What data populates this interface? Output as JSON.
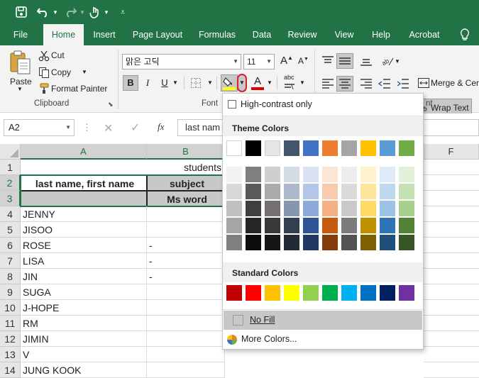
{
  "tabs": [
    "File",
    "Home",
    "Insert",
    "Page Layout",
    "Formulas",
    "Data",
    "Review",
    "View",
    "Help",
    "Acrobat"
  ],
  "clipboard": {
    "paste": "Paste",
    "cut": "Cut",
    "copy": "Copy",
    "format_painter": "Format Painter",
    "label": "Clipboard"
  },
  "font": {
    "name": "맑은 고딕",
    "size": "11",
    "label": "Font",
    "grow": "A",
    "shrink": "A",
    "bold": "B",
    "italic": "I",
    "underline": "U",
    "font_color_letter": "A",
    "phonetic": "abc"
  },
  "alignment": {
    "wrap_text": "Wrap Text",
    "merge": "Merge & Cer",
    "label": "nt"
  },
  "formula_bar": {
    "name_box": "A2",
    "fx": "fx",
    "content": "last nam"
  },
  "columns": [
    "A",
    "B",
    "F"
  ],
  "rows": [
    "1",
    "2",
    "3",
    "4",
    "5",
    "6",
    "7",
    "8",
    "9",
    "10",
    "11",
    "12",
    "13",
    "14"
  ],
  "cells": {
    "b1": "students",
    "a2": "last name, first name",
    "b2": "subject",
    "b3": "Ms word",
    "names": [
      "JENNY",
      "JISOO",
      "ROSE",
      "LISA",
      "JIN",
      "SUGA",
      "J-HOPE",
      "RM",
      "JIMIN",
      "V",
      "JUNG KOOK"
    ],
    "dash": "-"
  },
  "fill_menu": {
    "high_contrast": "High-contrast only",
    "theme_colors": "Theme Colors",
    "standard_colors": "Standard Colors",
    "no_fill": "No Fill",
    "more_colors": "More Colors...",
    "theme_top": [
      "#ffffff",
      "#000000",
      "#e7e6e6",
      "#44546a",
      "#4472c4",
      "#ed7d31",
      "#a5a5a5",
      "#ffc000",
      "#5b9bd5",
      "#70ad47"
    ],
    "theme_shades": [
      [
        "#f2f2f2",
        "#7f7f7f",
        "#d0cece",
        "#d6dce4",
        "#d9e2f3",
        "#fbe5d5",
        "#ededed",
        "#fff2cc",
        "#deebf6",
        "#e2efd9"
      ],
      [
        "#d8d8d8",
        "#595959",
        "#aeaaaa",
        "#adb9ca",
        "#b4c6e7",
        "#f7cbac",
        "#dbdbdb",
        "#fee599",
        "#bdd7ee",
        "#c5e0b3"
      ],
      [
        "#bfbfbf",
        "#3f3f3f",
        "#757070",
        "#8496b0",
        "#8eaadb",
        "#f4b183",
        "#c9c9c9",
        "#ffd965",
        "#9cc3e5",
        "#a8d08d"
      ],
      [
        "#a5a5a5",
        "#262626",
        "#3a3838",
        "#323f4f",
        "#2f5496",
        "#c55a11",
        "#7b7b7b",
        "#bf9000",
        "#2e75b5",
        "#538135"
      ],
      [
        "#7f7f7f",
        "#0c0c0c",
        "#171616",
        "#222a35",
        "#1f3864",
        "#833c0b",
        "#525252",
        "#7f6000",
        "#1e4e79",
        "#375623"
      ]
    ],
    "standard": [
      "#c00000",
      "#ff0000",
      "#ffc000",
      "#ffff00",
      "#92d050",
      "#00b050",
      "#00b0f0",
      "#0070c0",
      "#002060",
      "#7030a0"
    ]
  }
}
